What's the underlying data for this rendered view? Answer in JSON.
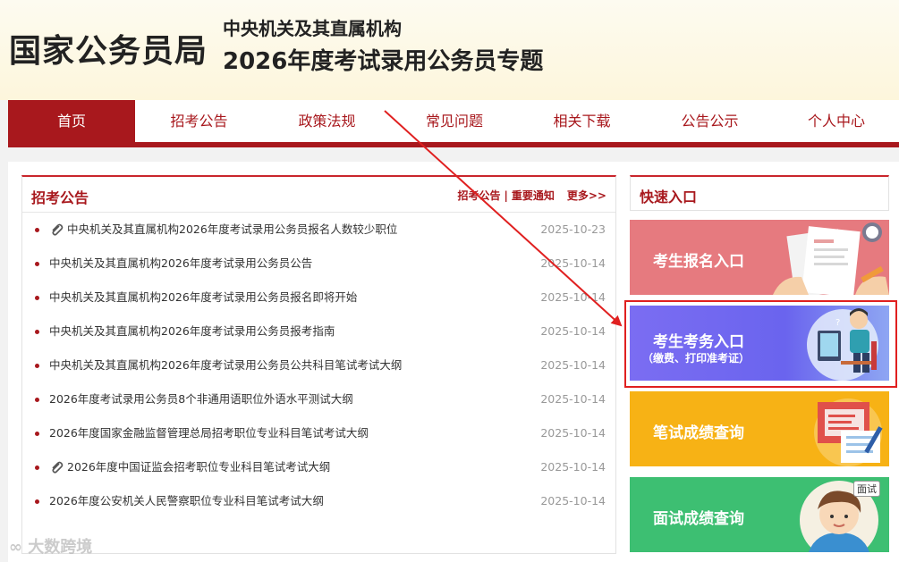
{
  "header": {
    "logo": "国家公务员局",
    "org": "中央机关及其直属机构",
    "topic": "2026年度考试录用公务员专题"
  },
  "nav": {
    "items": [
      "首页",
      "招考公告",
      "政策法规",
      "常见问题",
      "相关下载",
      "公告公示",
      "个人中心"
    ]
  },
  "notices": {
    "title": "招考公告",
    "link1": "招考公告",
    "sep": "|",
    "link2": "重要通知",
    "more": "更多>>",
    "items": [
      {
        "text": "中央机关及其直属机构2026年度考试录用公务员报名人数较少职位",
        "date": "2025-10-23",
        "attachment": true
      },
      {
        "text": "中央机关及其直属机构2026年度考试录用公务员公告",
        "date": "2025-10-14",
        "attachment": false
      },
      {
        "text": "中央机关及其直属机构2026年度考试录用公务员报名即将开始",
        "date": "2025-10-14",
        "attachment": false
      },
      {
        "text": "中央机关及其直属机构2026年度考试录用公务员报考指南",
        "date": "2025-10-14",
        "attachment": false
      },
      {
        "text": "中央机关及其直属机构2026年度考试录用公务员公共科目笔试考试大纲",
        "date": "2025-10-14",
        "attachment": false
      },
      {
        "text": "2026年度考试录用公务员8个非通用语职位外语水平测试大纲",
        "date": "2025-10-14",
        "attachment": false
      },
      {
        "text": "2026年度国家金融监督管理总局招考职位专业科目笔试考试大纲",
        "date": "2025-10-14",
        "attachment": false
      },
      {
        "text": "2026年度中国证监会招考职位专业科目笔试考试大纲",
        "date": "2025-10-14",
        "attachment": true
      },
      {
        "text": "2026年度公安机关人民警察职位专业科目笔试考试大纲",
        "date": "2025-10-14",
        "attachment": false
      }
    ]
  },
  "quick": {
    "title": "快速入口",
    "signup": "考生报名入口",
    "affairs": "考生考务入口",
    "affairs_sub": "（缴费、打印准考证）",
    "written": "笔试成绩查询",
    "interview": "面试成绩查询",
    "interview_badge": "面试"
  },
  "colors": {
    "brand_red": "#a8181d",
    "highlight_red": "#e02020",
    "signup_card": "#e67a7f",
    "affairs_card": "#7b6df2",
    "written_card": "#f7b215",
    "interview_card": "#3dbf72"
  },
  "watermark": "大数跨境"
}
